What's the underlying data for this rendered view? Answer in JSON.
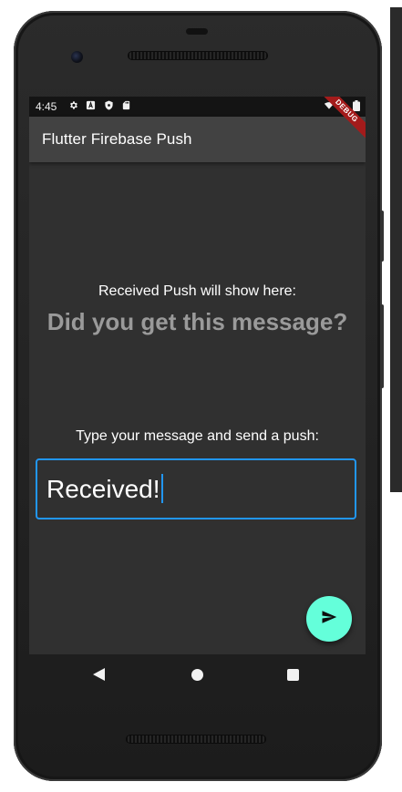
{
  "status_bar": {
    "time": "4:45",
    "icons": [
      "gear-icon",
      "a-icon",
      "shield-icon",
      "sd-card-icon",
      "wifi-icon",
      "battery-icon"
    ]
  },
  "app_bar": {
    "title": "Flutter Firebase Push",
    "debug_banner": "DEBUG"
  },
  "main": {
    "received_label": "Received Push will show here:",
    "received_message": "Did you get this message?",
    "type_label": "Type your message and send a push:",
    "message_input_value": "Received!"
  },
  "fab": {
    "icon": "send-icon"
  },
  "nav": {
    "icons": [
      "back-icon",
      "home-icon",
      "recents-icon"
    ]
  },
  "colors": {
    "background": "#303030",
    "app_bar": "#424242",
    "accent": "#64ffda",
    "focus": "#2196f3",
    "muted_text": "#9a9a9a"
  }
}
